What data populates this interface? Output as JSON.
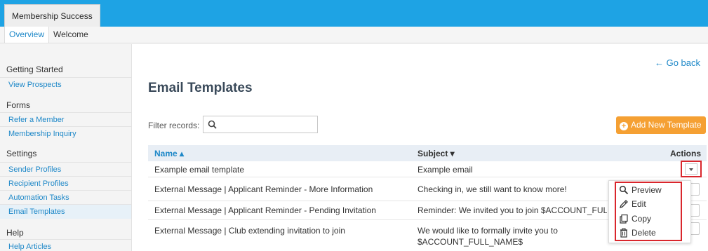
{
  "app": {
    "tab": "Membership Success"
  },
  "subnav": {
    "overview": "Overview",
    "welcome": "Welcome"
  },
  "sidebar": {
    "getting_started": "Getting Started",
    "view_prospects": "View Prospects",
    "forms": "Forms",
    "refer_member": "Refer a Member",
    "membership_inquiry": "Membership Inquiry",
    "settings": "Settings",
    "sender_profiles": "Sender Profiles",
    "recipient_profiles": "Recipient Profiles",
    "automation_tasks": "Automation Tasks",
    "email_templates": "Email Templates",
    "help": "Help",
    "help_articles": "Help Articles"
  },
  "page": {
    "go_back": "← Go back",
    "title": "Email Templates",
    "filter_label": "Filter records:",
    "filter_value": "",
    "add_button": "Add New Template"
  },
  "table": {
    "headers": {
      "name": "Name ▴",
      "subject": "Subject ▾",
      "actions": "Actions"
    },
    "rows": [
      {
        "name": "Example email template",
        "subject": "Example email"
      },
      {
        "name": "External Message | Applicant Reminder - More Information",
        "subject": "Checking in, we still want to know more!"
      },
      {
        "name": "External Message | Applicant Reminder - Pending Invitation",
        "subject": "Reminder: We invited you to join $ACCOUNT_FULL_NA"
      },
      {
        "name": "External Message | Club extending invitation to join",
        "subject": "We would like to formally invite you to",
        "subject_2": "$ACCOUNT_FULL_NAME$"
      }
    ]
  },
  "menu": {
    "preview": "Preview",
    "edit": "Edit",
    "copy": "Copy",
    "delete": "Delete"
  },
  "colors": {
    "topbar": "#1ea3e4",
    "link": "#1e88c8",
    "add_button": "#f5a033",
    "highlight": "#d9262c"
  }
}
